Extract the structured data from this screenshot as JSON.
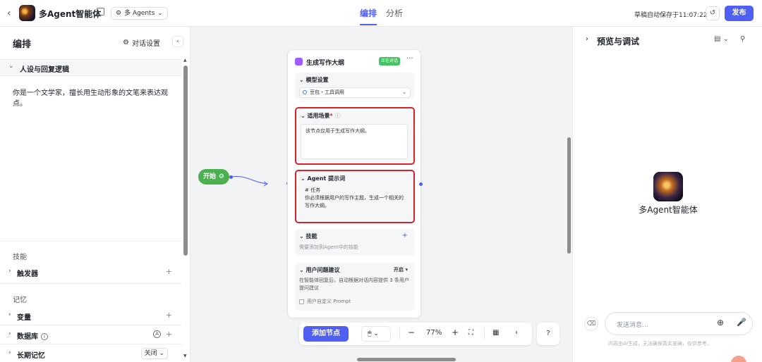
{
  "topbar": {
    "back_icon": "chevron-left-icon",
    "app_name": "多Agent智能体",
    "mode": "多 Agents",
    "tabs": [
      {
        "label": "编排"
      },
      {
        "label": "分析"
      }
    ],
    "autosave": "草稿自动保存于11:07:22",
    "publish": "发布",
    "accent": "#4e5ff2"
  },
  "left": {
    "title": "编排",
    "dialog_settings": "对话设置",
    "persona_section": "人设与回复逻辑",
    "persona_text": "你是一个文学家，擅长用生动形象的文笔来表达观点。",
    "skills_group": "技能",
    "triggers": "触发器",
    "memory_group": "记忆",
    "variables": "变量",
    "database": "数据库",
    "long_memory": "长期记忆",
    "long_memory_value": "关闭"
  },
  "canvas": {
    "start_node": "开始",
    "node": {
      "title": "生成写作大纲",
      "badge": "正在对话",
      "model_section": "模型设置",
      "model_value": "豆包・工具调用",
      "scenario_label": "适用场景",
      "scenario_required": "*",
      "scenario_text": "该节点仅用于生成写作大纲。",
      "prompt_label": "Agent 提示词",
      "prompt_text_1": "# 任务",
      "prompt_text_2": "你必须根据用户的写作主题，生成一个相关的写作大纲。",
      "skills_label": "技能",
      "skills_hint": "需要添加到Agent中的技能",
      "suggest_label": "用户问题建议",
      "suggest_value": "开启",
      "suggest_desc": "在智能体回复后，自动根据对话内容提供 3 条用户提问建议",
      "custom_prompt": "用户自定义 Prompt"
    },
    "toolbar": {
      "add_node": "添加节点",
      "zoom": "77%",
      "minus": "−",
      "plus": "+"
    }
  },
  "right": {
    "title": "预览与调试",
    "bot_name": "多Agent智能体",
    "input_placeholder": "发送消息...",
    "disclaimer": "内容由AI生成，无法确保真实准确，仅供参考。"
  }
}
